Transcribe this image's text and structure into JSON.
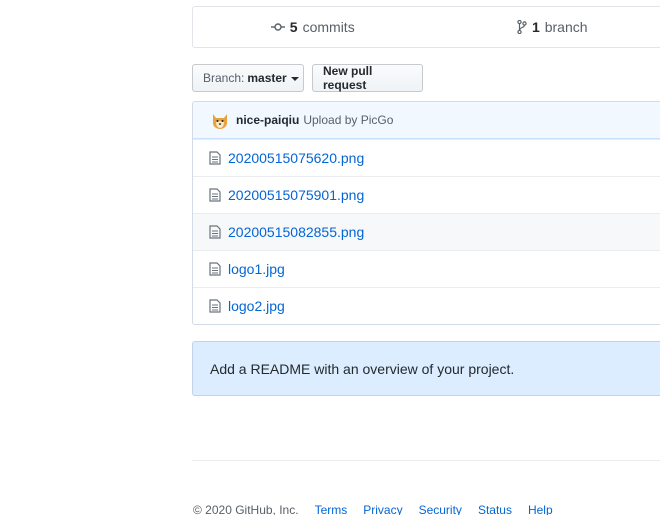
{
  "summary": {
    "commits_count": "5",
    "commits_label": "commits",
    "branches_count": "1",
    "branches_label": "branch"
  },
  "toolbar": {
    "branch_label": "Branch:",
    "branch_value": "master",
    "new_pr_label": "New pull request"
  },
  "latest_commit": {
    "author": "nice-paiqiu",
    "message": "Upload by PicGo"
  },
  "files": [
    {
      "name": "20200515075620.png"
    },
    {
      "name": "20200515075901.png"
    },
    {
      "name": "20200515082855.png"
    },
    {
      "name": "logo1.jpg"
    },
    {
      "name": "logo2.jpg"
    }
  ],
  "readme_prompt": "Add a README with an overview of your project.",
  "footer": {
    "copyright": "© 2020 GitHub, Inc.",
    "links": [
      "Terms",
      "Privacy",
      "Security",
      "Status",
      "Help"
    ]
  },
  "colors": {
    "link": "#0366d6",
    "tease_bg": "#f1f8ff",
    "readme_bg": "#dbedff"
  },
  "icons": {
    "commits": "git-commit-icon",
    "branch": "git-branch-icon",
    "file": "file-icon",
    "avatar": "shiba-avatar"
  }
}
